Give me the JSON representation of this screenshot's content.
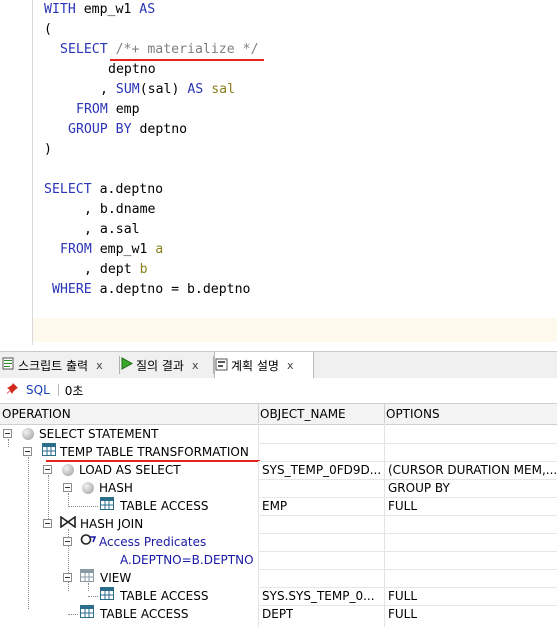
{
  "editor": {
    "lines": {
      "l1": {
        "kw1": "WITH",
        "t1": " emp_w1 ",
        "kw2": "AS"
      },
      "l2": {
        "t1": "("
      },
      "l3": {
        "kw1": "SELECT",
        "cm1": "/*+ materialize */"
      },
      "l4": {
        "t1": "deptno"
      },
      "l5": {
        "t1": ", ",
        "kw1": "SUM",
        "t2": "(sal) ",
        "kw2": "AS",
        "ol1": "sal"
      },
      "l6": {
        "kw1": "FROM",
        "t1": " emp"
      },
      "l7": {
        "kw1": "GROUP BY",
        "t1": " deptno"
      },
      "l8": {
        "t1": ")"
      },
      "l9": {
        "kw1": "SELECT",
        "t1": " a.deptno"
      },
      "l10": {
        "t1": ", b.dname"
      },
      "l11": {
        "t1": ", a.sal"
      },
      "l12": {
        "kw1": "FROM",
        "t1": " emp_w1 ",
        "ol1": "a"
      },
      "l13": {
        "t1": ", dept ",
        "ol1": "b"
      },
      "l14": {
        "kw1": "WHERE",
        "t1": " a.deptno = b.deptno"
      }
    }
  },
  "tabs": [
    {
      "label": "스크립트 출력",
      "close": "x",
      "icon": "script-output-icon"
    },
    {
      "label": "질의 결과",
      "close": "x",
      "icon": "run-query-icon"
    },
    {
      "label": "계획 설명",
      "close": "x",
      "icon": "explain-plan-icon",
      "active": true
    }
  ],
  "toolbar": {
    "pin_icon": "pin-icon",
    "sql_label": "SQL",
    "time_label": "0초"
  },
  "grid": {
    "headers": {
      "operation": "OPERATION",
      "object_name": "OBJECT_NAME",
      "options": "OPTIONS"
    },
    "rows": {
      "r0": {
        "operation": "SELECT STATEMENT",
        "object_name": "",
        "options": "",
        "icon": "plan-node-icon"
      },
      "r1": {
        "operation": "TEMP TABLE TRANSFORMATION",
        "object_name": "",
        "options": "",
        "icon": "table-icon"
      },
      "r2": {
        "operation": "LOAD AS SELECT",
        "object_name": "SYS_TEMP_0FD9D...",
        "options": "(CURSOR DURATION MEM,...",
        "icon": "plan-node-icon"
      },
      "r3": {
        "operation": "HASH",
        "object_name": "",
        "options": "GROUP BY",
        "icon": "plan-node-icon"
      },
      "r4": {
        "operation": "TABLE ACCESS",
        "object_name": "EMP",
        "options": "FULL",
        "icon": "table-icon"
      },
      "r5": {
        "operation": "HASH JOIN",
        "object_name": "",
        "options": "",
        "icon": "hash-join-icon"
      },
      "r6": {
        "operation": "Access Predicates",
        "object_name": "",
        "options": "",
        "icon": "predicate-icon"
      },
      "r7": {
        "operation": "A.DEPTNO=B.DEPTNO",
        "object_name": "",
        "options": ""
      },
      "r8": {
        "operation": "VIEW",
        "object_name": "",
        "options": "",
        "icon": "view-icon"
      },
      "r9": {
        "operation": "TABLE ACCESS",
        "object_name": "SYS.SYS_TEMP_0...",
        "options": "FULL",
        "icon": "table-icon"
      },
      "r10": {
        "operation": "TABLE ACCESS",
        "object_name": "DEPT",
        "options": "FULL",
        "icon": "table-icon"
      }
    }
  },
  "colors": {
    "keyword": "#2a35b8",
    "comment": "#808080",
    "alias": "#8a7f1d",
    "annotation_underline": "#e52420",
    "predicate": "#1a1aa6"
  }
}
